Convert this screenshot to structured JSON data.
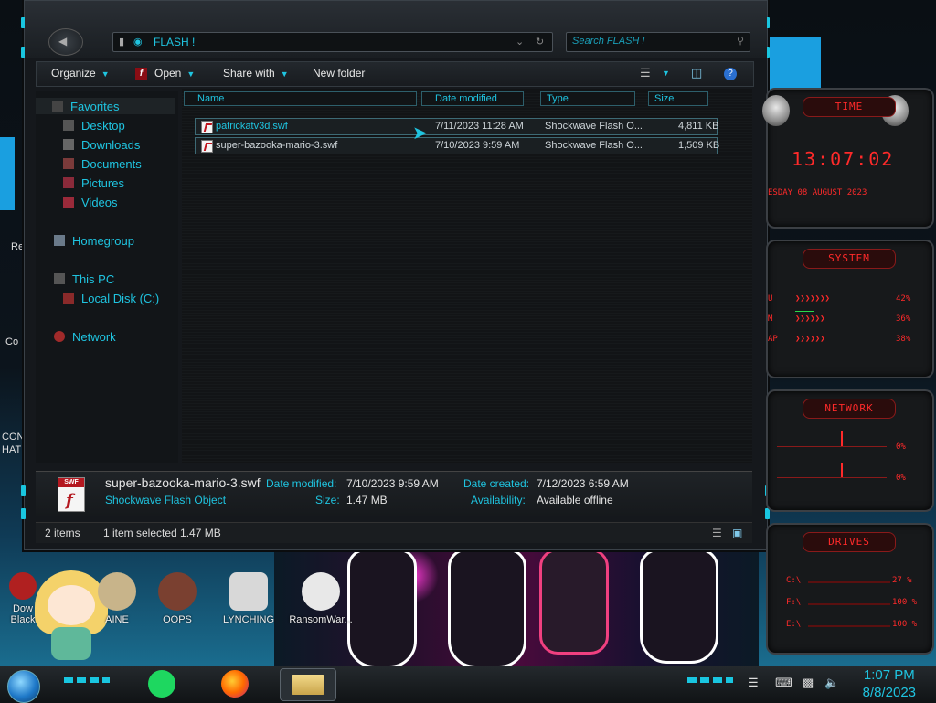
{
  "window": {
    "address": "FLASH !",
    "search_placeholder": "Search FLASH !"
  },
  "toolbar": {
    "organize": "Organize",
    "open": "Open",
    "share_with": "Share with",
    "new_folder": "New folder"
  },
  "nav": {
    "favorites": "Favorites",
    "desktop": "Desktop",
    "downloads": "Downloads",
    "documents": "Documents",
    "pictures": "Pictures",
    "videos": "Videos",
    "homegroup": "Homegroup",
    "this_pc": "This PC",
    "local_disk": "Local Disk (C:)",
    "network": "Network"
  },
  "columns": {
    "name": "Name",
    "date_modified": "Date modified",
    "type": "Type",
    "size": "Size"
  },
  "files": [
    {
      "name": "patrickatv3d.swf",
      "date": "7/11/2023 11:28 AM",
      "type": "Shockwave Flash O...",
      "size": "4,811 KB"
    },
    {
      "name": "super-bazooka-mario-3.swf",
      "date": "7/10/2023 9:59 AM",
      "type": "Shockwave Flash O...",
      "size": "1,509 KB"
    }
  ],
  "details": {
    "filename": "super-bazooka-mario-3.swf",
    "filetype": "Shockwave Flash Object",
    "date_modified_label": "Date modified:",
    "date_modified": "7/10/2023 9:59 AM",
    "size_label": "Size:",
    "size": "1.47 MB",
    "date_created_label": "Date created:",
    "date_created": "7/12/2023 6:59 AM",
    "availability_label": "Availability:",
    "availability": "Available offline",
    "icon_badge": "SWF"
  },
  "status": {
    "items": "2 items",
    "selected": "1 item selected  1.47 MB"
  },
  "gadgets": {
    "time_title": "TIME",
    "time": "13:07:02",
    "date": "ESDAY 08 AUGUST 2023",
    "system_title": "SYSTEM",
    "system_rows": [
      {
        "label": "U",
        "value": "42%"
      },
      {
        "label": "M",
        "value": "36%"
      },
      {
        "label": "AP",
        "value": "38%"
      }
    ],
    "network_title": "NETWORK",
    "network_rows": [
      "0%",
      "0%"
    ],
    "drives_title": "DRIVES",
    "drive_rows": [
      {
        "label": "C:\\",
        "value": "27 %"
      },
      {
        "label": "F:\\",
        "value": "100 %"
      },
      {
        "label": "E:\\",
        "value": "100 %"
      }
    ]
  },
  "desktop_edge": {
    "re": "Re",
    "co": "Co",
    "con": "CON",
    "hat": "HAT"
  },
  "desktop_icons": [
    {
      "label": "Dow\nBlack",
      "id": "dow"
    },
    {
      "label": "AINE",
      "id": "aine"
    },
    {
      "label": "OOPS",
      "id": "oops"
    },
    {
      "label": "LYNCHING",
      "id": "lynching"
    },
    {
      "label": "RansomWar...",
      "id": "ransomware"
    }
  ],
  "clock": {
    "time": "1:07 PM",
    "date": "8/8/2023"
  },
  "colors": {
    "accent": "#1fc4e0",
    "gadget_red": "#ff2a2a"
  }
}
